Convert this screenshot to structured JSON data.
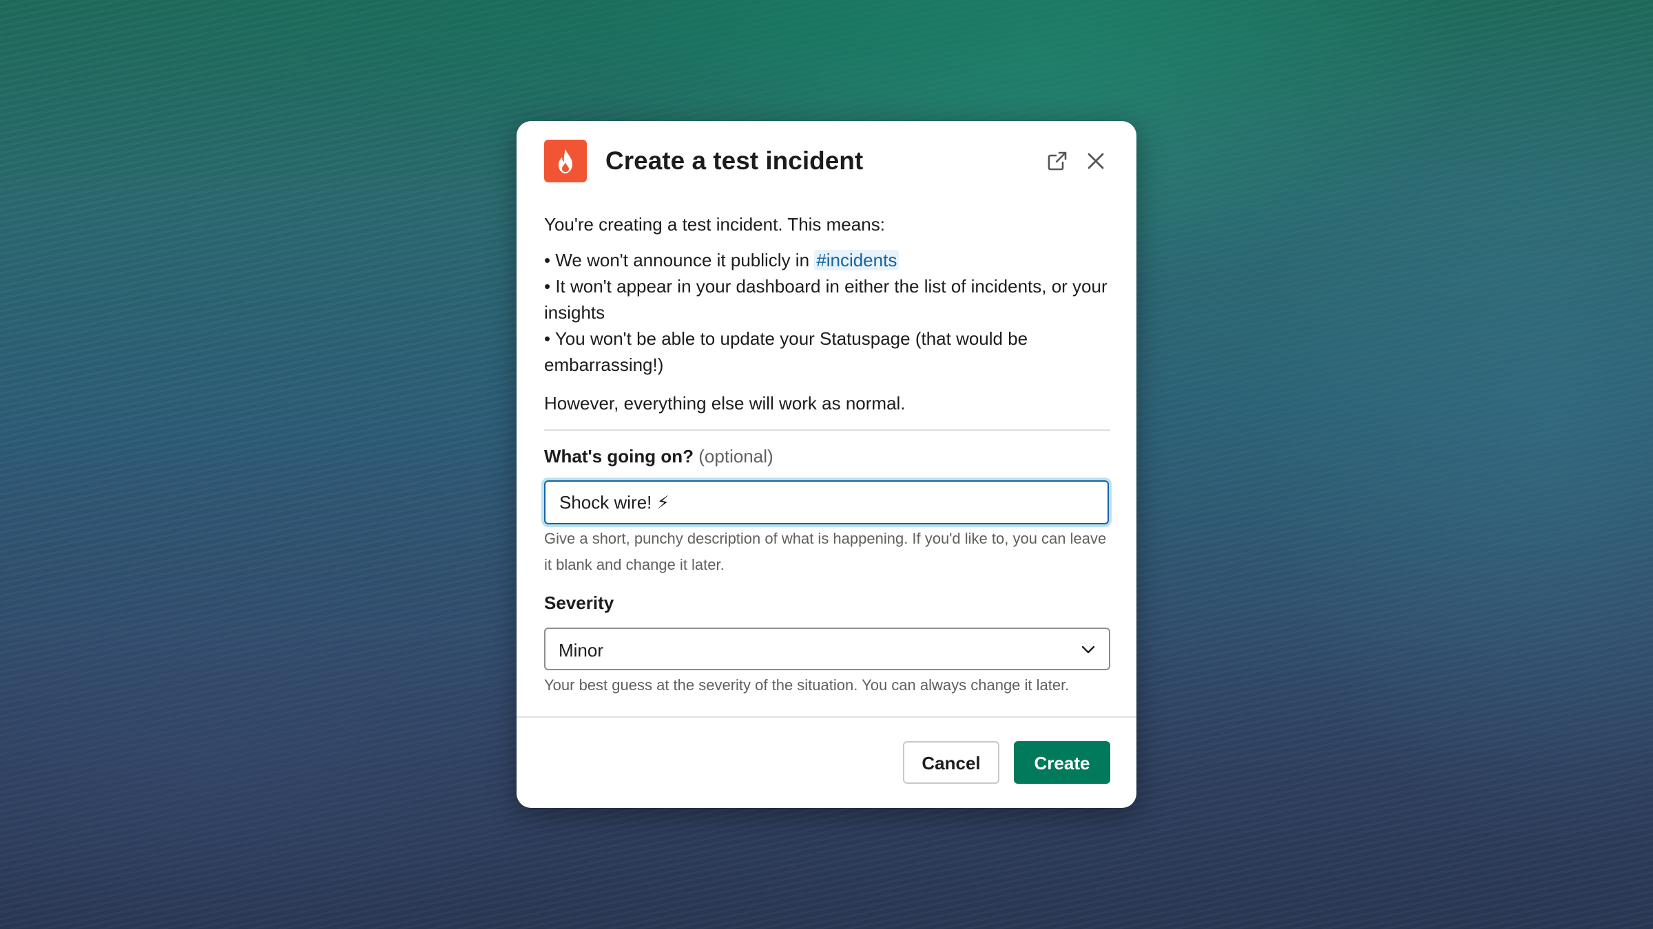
{
  "modal": {
    "title": "Create a test incident",
    "app_icon": "flame-icon",
    "popout_icon": "external-link-icon",
    "close_icon": "close-icon",
    "intro": "You're creating a test incident. This means:",
    "bullets": [
      {
        "text": "• We won't announce it publicly in ",
        "link": "#incidents"
      },
      {
        "text": "• It won't appear in your dashboard in either the list of incidents, or your insights"
      },
      {
        "text": "• You won't be able to update your Statuspage (that would be embarrassing!)"
      }
    ],
    "outro": "However, everything else will work as normal.",
    "fields": {
      "description": {
        "label": "What's going on?",
        "optional": "(optional)",
        "value": "Shock wire! ⚡",
        "hint": "Give a short, punchy description of what is happening. If you'd like to, you can leave it blank and change it later."
      },
      "severity": {
        "label": "Severity",
        "value": "Minor",
        "hint": "Your best guess at the severity of the situation. You can always change it later.",
        "icon": "chevron-down-icon"
      }
    },
    "buttons": {
      "cancel": "Cancel",
      "create": "Create"
    },
    "colors": {
      "primary": "#007a5a",
      "brand": "#f25533",
      "link": "#1264a3"
    }
  }
}
